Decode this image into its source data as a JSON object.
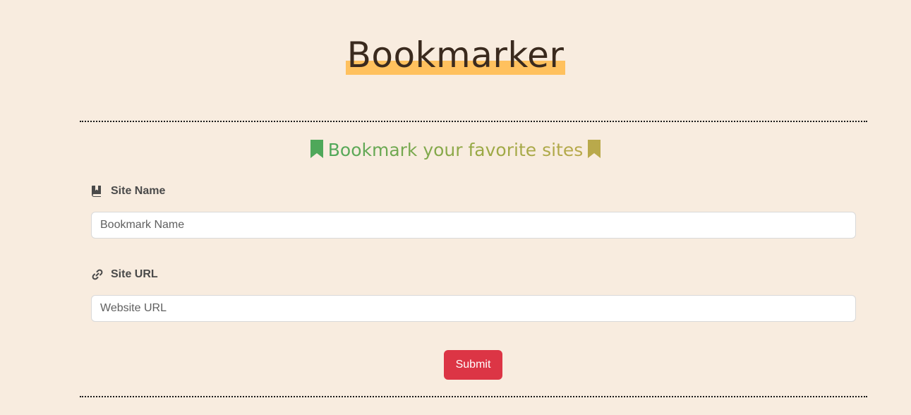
{
  "header": {
    "title": "Bookmarker"
  },
  "form": {
    "subtitle": "Bookmark your favorite sites",
    "site_name": {
      "label": "Site Name",
      "placeholder": "Bookmark Name",
      "value": "",
      "icon": "book-icon"
    },
    "site_url": {
      "label": "Site URL",
      "placeholder": "Website URL",
      "value": "",
      "icon": "link-icon"
    },
    "submit_label": "Submit"
  },
  "colors": {
    "background": "#f8ecdf",
    "title_highlight": "#ffc15e",
    "subtitle_start": "#4fa85a",
    "subtitle_end": "#b9a94b",
    "submit": "#dc3545"
  }
}
